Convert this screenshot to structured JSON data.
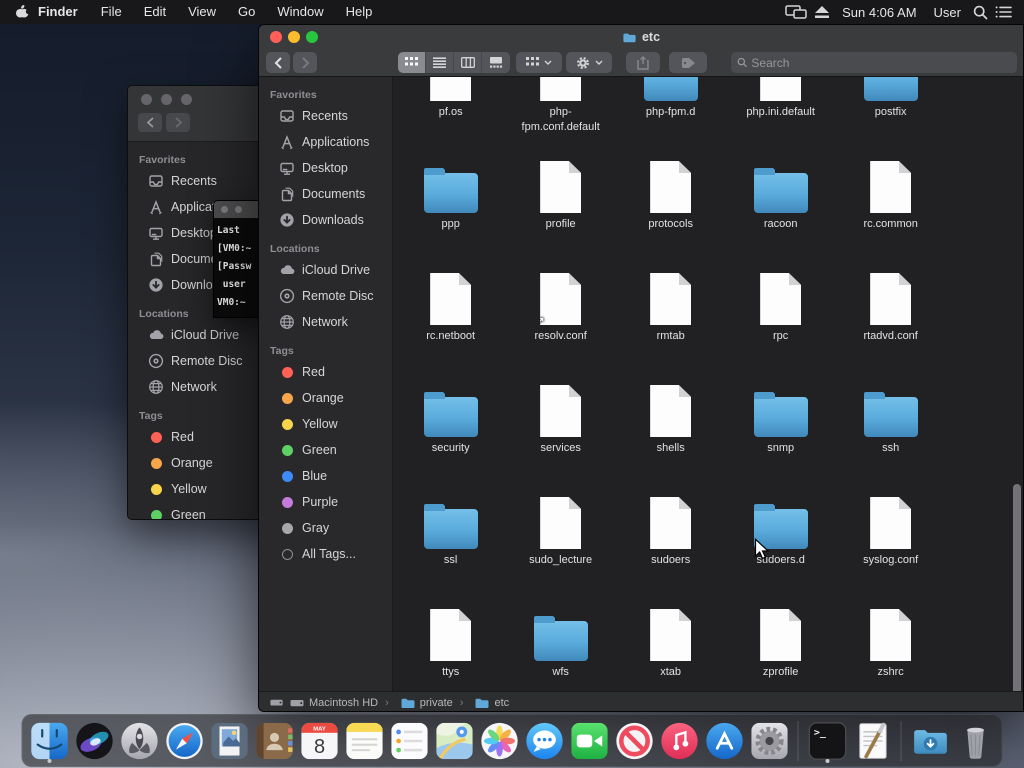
{
  "menu_bar": {
    "app_menus": [
      "Finder",
      "File",
      "Edit",
      "View",
      "Go",
      "Window",
      "Help"
    ],
    "status": {
      "time": "Sun 4:06 AM",
      "user_label": "User"
    }
  },
  "front_window": {
    "title": "etc",
    "toolbar": {
      "search_placeholder": "Search"
    },
    "sidebar": {
      "favorites": {
        "title": "Favorites",
        "items": [
          {
            "label": "Recents",
            "icon": "sb-recents"
          },
          {
            "label": "Applications",
            "icon": "sb-apps"
          },
          {
            "label": "Desktop",
            "icon": "sb-desktop"
          },
          {
            "label": "Documents",
            "icon": "sb-docs"
          },
          {
            "label": "Downloads",
            "icon": "sb-downloads"
          }
        ]
      },
      "locations": {
        "title": "Locations",
        "items": [
          {
            "label": "iCloud Drive",
            "icon": "sb-cloud"
          },
          {
            "label": "Remote Disc",
            "icon": "sb-disc"
          },
          {
            "label": "Network",
            "icon": "sb-globe"
          }
        ]
      },
      "tags": {
        "title": "Tags",
        "items": [
          {
            "label": "Red",
            "color": "#ff6157"
          },
          {
            "label": "Orange",
            "color": "#f7a64b"
          },
          {
            "label": "Yellow",
            "color": "#f7d44c"
          },
          {
            "label": "Green",
            "color": "#5fd164"
          },
          {
            "label": "Blue",
            "color": "#3f8af7"
          },
          {
            "label": "Purple",
            "color": "#c57bdb"
          },
          {
            "label": "Gray",
            "color": "#a8a8ac"
          },
          {
            "label": "All Tags...",
            "variant": "ring"
          }
        ]
      }
    },
    "files": [
      {
        "label": "pf.os",
        "type": "file"
      },
      {
        "label": "php-fpm.conf.default",
        "type": "file"
      },
      {
        "label": "php-fpm.d",
        "type": "folder"
      },
      {
        "label": "php.ini.default",
        "type": "file"
      },
      {
        "label": "postfix",
        "type": "folder"
      },
      {
        "label": "ppp",
        "type": "folder"
      },
      {
        "label": "profile",
        "type": "file"
      },
      {
        "label": "protocols",
        "type": "file"
      },
      {
        "label": "racoon",
        "type": "folder"
      },
      {
        "label": "rc.common",
        "type": "file"
      },
      {
        "label": "rc.netboot",
        "type": "file"
      },
      {
        "label": "resolv.conf",
        "type": "file",
        "alias": true
      },
      {
        "label": "rmtab",
        "type": "file"
      },
      {
        "label": "rpc",
        "type": "file"
      },
      {
        "label": "rtadvd.conf",
        "type": "file"
      },
      {
        "label": "security",
        "type": "folder"
      },
      {
        "label": "services",
        "type": "file"
      },
      {
        "label": "shells",
        "type": "file"
      },
      {
        "label": "snmp",
        "type": "folder"
      },
      {
        "label": "ssh",
        "type": "folder"
      },
      {
        "label": "ssl",
        "type": "folder"
      },
      {
        "label": "sudo_lecture",
        "type": "file"
      },
      {
        "label": "sudoers",
        "type": "file"
      },
      {
        "label": "sudoers.d",
        "type": "folder"
      },
      {
        "label": "syslog.conf",
        "type": "file"
      },
      {
        "label": "ttys",
        "type": "file"
      },
      {
        "label": "wfs",
        "type": "folder"
      },
      {
        "label": "xtab",
        "type": "file"
      },
      {
        "label": "zprofile",
        "type": "file"
      },
      {
        "label": "zshrc",
        "type": "file"
      }
    ],
    "path_bar": {
      "items": [
        {
          "label": "Macintosh HD",
          "icon": "pb-hdd"
        },
        {
          "label": "private",
          "icon": "pb-folder"
        },
        {
          "label": "etc",
          "icon": "pb-folder"
        }
      ]
    }
  },
  "terminal": {
    "lines": [
      "Last",
      "[VM0:~",
      "[Passw",
      " user",
      "VM0:~"
    ]
  },
  "dock": {
    "apps": [
      {
        "name": "finder",
        "icon": "app-finder",
        "running": true
      },
      {
        "name": "siri",
        "icon": "app-siri"
      },
      {
        "name": "launchpad",
        "icon": "app-launchpad"
      },
      {
        "name": "safari",
        "icon": "app-safari"
      },
      {
        "name": "mail",
        "icon": "app-mail"
      },
      {
        "name": "contacts",
        "icon": "app-contacts"
      },
      {
        "name": "calendar",
        "icon": "app-calendar"
      },
      {
        "name": "notes",
        "icon": "app-notes"
      },
      {
        "name": "reminders",
        "icon": "app-reminders"
      },
      {
        "name": "maps",
        "icon": "app-maps"
      },
      {
        "name": "photos",
        "icon": "app-photos"
      },
      {
        "name": "messages",
        "icon": "app-messages"
      },
      {
        "name": "facetime",
        "icon": "app-facetime"
      },
      {
        "name": "news",
        "icon": "app-news"
      },
      {
        "name": "itunes",
        "icon": "app-itunes"
      },
      {
        "name": "app-store",
        "icon": "app-appstore"
      },
      {
        "name": "system-preferences",
        "icon": "app-sysprefs"
      }
    ],
    "tools": [
      {
        "name": "terminal",
        "icon": "app-terminal",
        "running": true
      },
      {
        "name": "textedit",
        "icon": "app-textedit"
      }
    ],
    "others": [
      {
        "name": "downloads-folder",
        "icon": "app-downloads"
      },
      {
        "name": "trash",
        "icon": "app-trash"
      }
    ]
  }
}
